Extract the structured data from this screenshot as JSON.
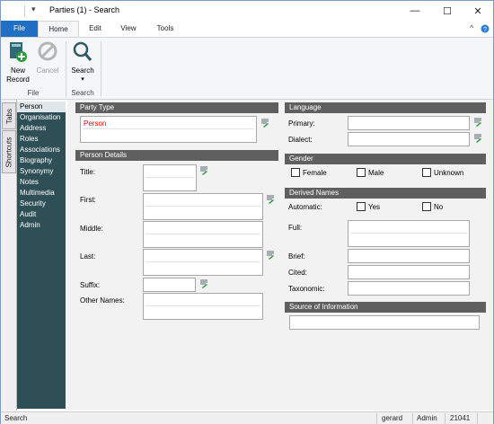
{
  "window": {
    "title": "Parties (1) - Search",
    "menu_glyph": "▾",
    "minimize": "—",
    "maximize": "☐",
    "close": "✕"
  },
  "ribbon": {
    "tabs": [
      "File",
      "Home",
      "Edit",
      "View",
      "Tools"
    ],
    "collapse_glyph": "^",
    "help_glyph": "?",
    "buttons": {
      "new_record_line1": "New",
      "new_record_line2": "Record",
      "cancel": "Cancel",
      "search": "Search",
      "search_dropdown": "▾"
    },
    "groups": {
      "file": "File",
      "search": "Search"
    }
  },
  "side_tabs": [
    "Tabs",
    "Shortcuts"
  ],
  "nav": {
    "items": [
      "Person",
      "Organisation",
      "Address",
      "Roles",
      "Associations",
      "Biography",
      "Synonymy",
      "Notes",
      "Multimedia",
      "Security",
      "Audit",
      "Admin"
    ],
    "active_index": 0
  },
  "form": {
    "party_type": {
      "header": "Party Type",
      "value": "Person"
    },
    "person_details": {
      "header": "Person Details",
      "title": "Title:",
      "first": "First:",
      "middle": "Middle:",
      "last": "Last:",
      "suffix": "Suffix:",
      "other_names": "Other Names:"
    },
    "language": {
      "header": "Language",
      "primary": "Primary:",
      "dialect": "Dialect:"
    },
    "gender": {
      "header": "Gender",
      "options": [
        "Female",
        "Male",
        "Unknown"
      ]
    },
    "derived_names": {
      "header": "Derived Names",
      "automatic": "Automatic:",
      "yes": "Yes",
      "no": "No",
      "full": "Full:",
      "brief": "Brief:",
      "cited": "Cited:",
      "taxonomic": "Taxonomic:"
    },
    "source": {
      "header": "Source of Information"
    }
  },
  "status": {
    "mode": "Search",
    "user": "gerard",
    "role": "Admin",
    "id": "21041"
  },
  "colors": {
    "file_tab": "#1f6fc5",
    "nav_bg": "#2e4f55",
    "section_header": "#5f5f5f",
    "required_text": "#e00000",
    "accent_green": "#2a9a3a"
  }
}
